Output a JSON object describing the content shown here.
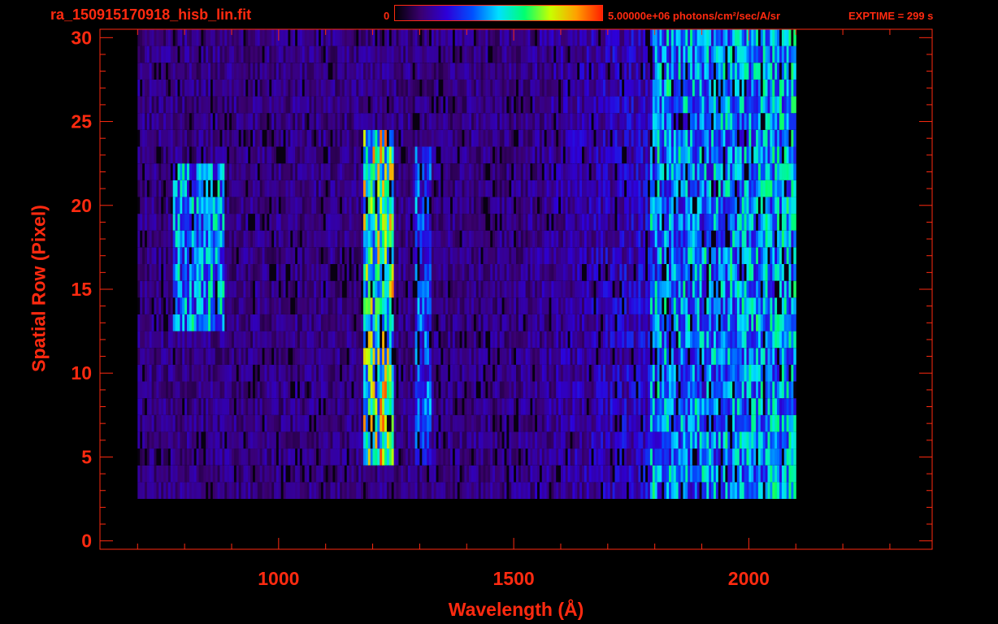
{
  "header": {
    "file_name": "ra_150915170918_hisb_lin.fit",
    "colorbar_min": "0",
    "colorbar_max_label": "5.00000e+06 photons/cm²/sec/A/sr",
    "exptime": "EXPTIME = 299 s"
  },
  "colors": {
    "axis": "#ff2a10",
    "background": "#000000",
    "colormap": [
      "#000000",
      "#3a0070",
      "#2d00d8",
      "#0050ff",
      "#00e0ff",
      "#00ff70",
      "#c8ff00",
      "#ffa000",
      "#ff2000"
    ]
  },
  "chart_data": {
    "type": "heatmap",
    "title": "ra_150915170918_hisb_lin.fit",
    "xlabel": "Wavelength (Å)",
    "ylabel": "Spatial Row (Pixel)",
    "xlim": [
      620,
      2390
    ],
    "ylim": [
      -0.5,
      30.5
    ],
    "x_ticks": [
      1000,
      1500,
      2000
    ],
    "y_ticks": [
      0,
      5,
      10,
      15,
      20,
      25,
      30
    ],
    "colorbar_range": [
      0,
      5000000
    ],
    "colorbar_unit": "photons/cm²/sec/A/sr",
    "data_x_range": [
      700,
      2100
    ],
    "data_rows": [
      3,
      30
    ],
    "features": [
      {
        "x_range": [
          775,
          880
        ],
        "rows": [
          13,
          22
        ],
        "peak_intensity": 0.55
      },
      {
        "x_range": [
          1180,
          1240
        ],
        "rows": [
          5,
          24
        ],
        "peak_intensity": 0.82
      },
      {
        "x_range": [
          1290,
          1320
        ],
        "rows": [
          5,
          23
        ],
        "peak_intensity": 0.45
      },
      {
        "x_range": [
          1790,
          2070
        ],
        "rows": [
          3,
          30
        ],
        "peak_intensity": 0.55
      }
    ]
  }
}
